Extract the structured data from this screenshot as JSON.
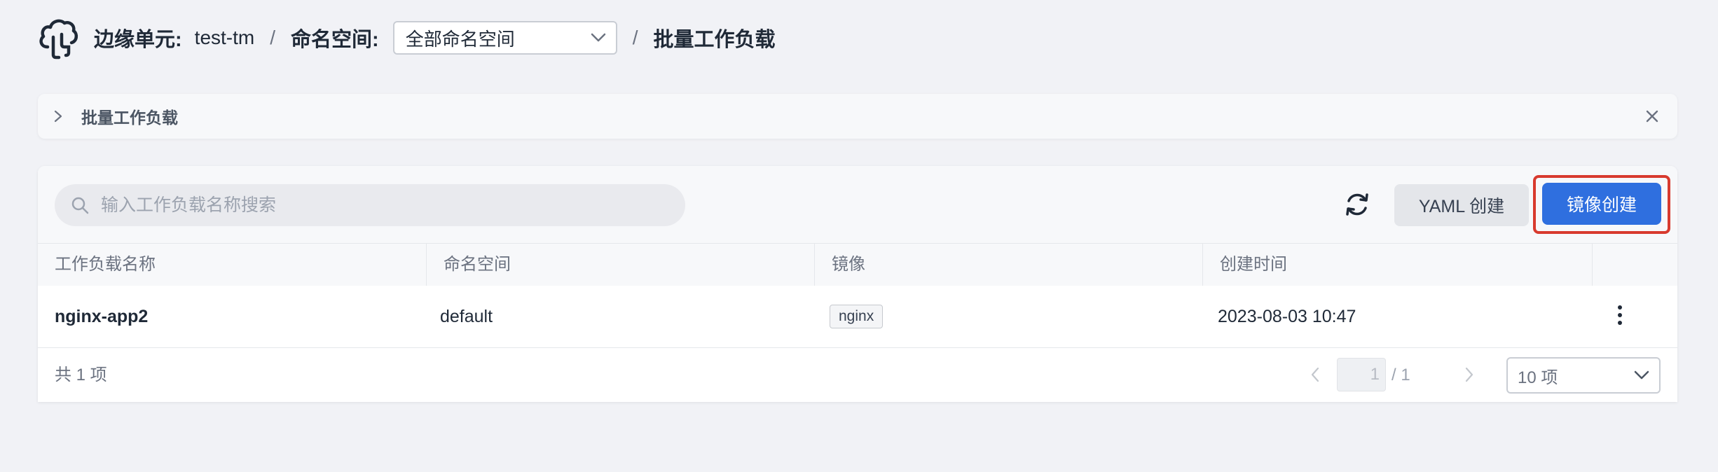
{
  "header": {
    "edge_unit_label": "边缘单元:",
    "edge_unit_value": "test-tm",
    "separator": "/",
    "namespace_label": "命名空间:",
    "namespace_selected": "全部命名空间",
    "page_title": "批量工作负载"
  },
  "banner": {
    "title": "批量工作负载"
  },
  "toolbar": {
    "search_placeholder": "输入工作负载名称搜索",
    "yaml_create_label": "YAML 创建",
    "image_create_label": "镜像创建"
  },
  "table": {
    "columns": [
      "工作负载名称",
      "命名空间",
      "镜像",
      "创建时间"
    ],
    "rows": [
      {
        "name": "nginx-app2",
        "namespace": "default",
        "image": "nginx",
        "created_at": "2023-08-03 10:47"
      }
    ]
  },
  "footer": {
    "total_text": "共 1 项",
    "current_page": "1",
    "total_pages_text": "/ 1",
    "page_size": "10 项"
  },
  "colors": {
    "accent": "#2f6fdf",
    "highlight_border": "#d83a2e",
    "background": "#f1f2f6"
  }
}
